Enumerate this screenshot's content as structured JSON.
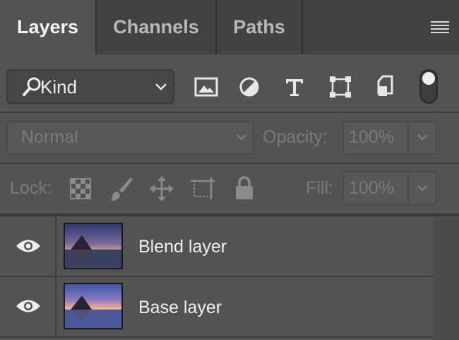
{
  "tabs": [
    {
      "label": "Layers",
      "active": true
    },
    {
      "label": "Channels",
      "active": false
    },
    {
      "label": "Paths",
      "active": false
    }
  ],
  "filter": {
    "kind_label": "Kind",
    "icons": [
      "image-filter-icon",
      "adjustment-filter-icon",
      "type-filter-icon",
      "shape-filter-icon",
      "smart-object-filter-icon",
      "filter-toggle-switch"
    ]
  },
  "blend": {
    "mode": "Normal",
    "opacity_label": "Opacity:",
    "opacity_value": "100%"
  },
  "lock": {
    "label": "Lock:",
    "fill_label": "Fill:",
    "fill_value": "100%"
  },
  "layers": [
    {
      "name": "Blend layer",
      "visible": true
    },
    {
      "name": "Base layer",
      "visible": true
    }
  ]
}
